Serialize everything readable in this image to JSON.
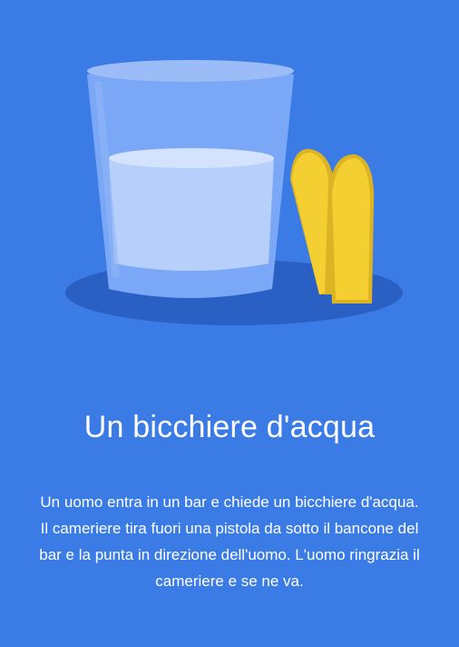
{
  "colors": {
    "background": "#3b7be6",
    "shadow": "#2a5fc4",
    "glass_outer": "#7aa8f6",
    "glass_rim": "#9cbcf7",
    "water": "#b6d0fb",
    "water_surface": "#d4e3fd",
    "bullet": "#f4cf31",
    "bullet_shade": "#dcb322"
  },
  "icons": {
    "glass": "water-glass-icon",
    "bullets": "bullet-icon"
  },
  "card": {
    "title": "Un bicchiere d'acqua",
    "text": "Un uomo entra in un bar e chiede un bicchiere d'acqua. Il cameriere tira fuori una pistola da sotto il bancone del bar e la punta in direzione dell'uomo. L'uomo ringrazia il cameriere e se ne va."
  }
}
